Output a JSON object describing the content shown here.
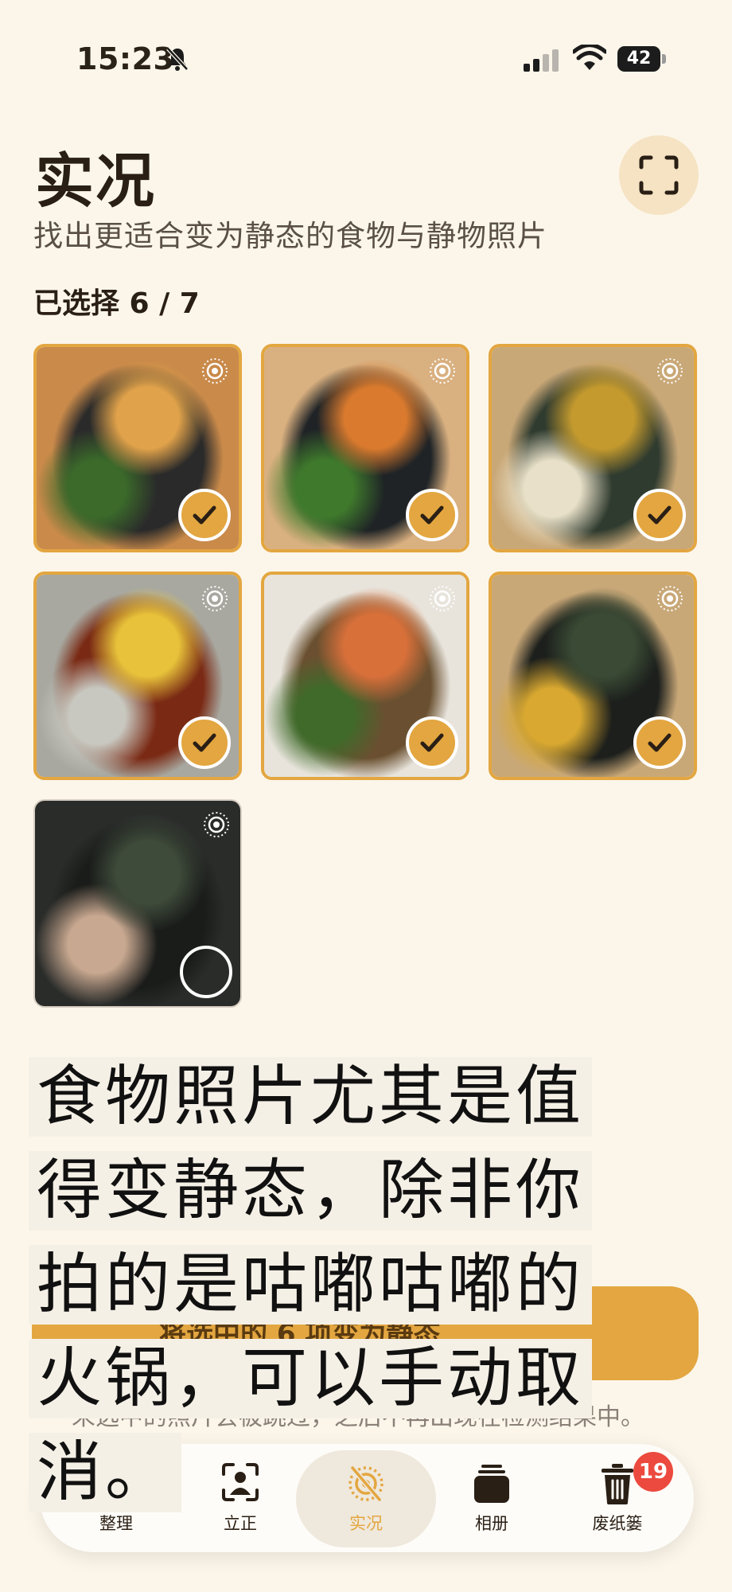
{
  "status_bar": {
    "time": "15:23",
    "battery": "42",
    "icons": [
      "bell-slash-icon",
      "signal-icon",
      "wifi-icon",
      "battery-icon"
    ]
  },
  "header": {
    "title": "实况",
    "subtitle": "找出更适合变为静态的食物与静物照片",
    "scan_icon": "scan-frame-icon"
  },
  "selection": {
    "label": "已选择 6 / 7"
  },
  "photos": [
    {
      "subject": "bibimbap table",
      "selected": true,
      "colors": [
        "#c98a4a",
        "#2a2a2a",
        "#e0a24a",
        "#3b6a2a"
      ]
    },
    {
      "subject": "bibimbap bowl",
      "selected": true,
      "colors": [
        "#d9b080",
        "#1f2326",
        "#d97a2e",
        "#3f7a2c"
      ]
    },
    {
      "subject": "soup bowl",
      "selected": true,
      "colors": [
        "#c9a878",
        "#2f3b2f",
        "#c49a2e",
        "#e8e0c8"
      ]
    },
    {
      "subject": "fried chicken",
      "selected": true,
      "colors": [
        "#a8a8a0",
        "#7a2a14",
        "#e8c23a",
        "#c8c8c0"
      ]
    },
    {
      "subject": "noodles with shrimp",
      "selected": true,
      "colors": [
        "#e8e4dc",
        "#6a5030",
        "#d8703a",
        "#3f6a2a"
      ]
    },
    {
      "subject": "kimbap plate",
      "selected": true,
      "colors": [
        "#c9a878",
        "#1c1f1c",
        "#3a4a34",
        "#d8a830"
      ]
    },
    {
      "subject": "kimbap close-up",
      "selected": false,
      "colors": [
        "#2a2c2a",
        "#1a1c1a",
        "#3e4a3a",
        "#c8a890"
      ]
    }
  ],
  "action": {
    "label": "将选中的 6 项变为静态",
    "note": "未选中的照片会被跳过，之后不再出现在检测结果中。"
  },
  "caption": {
    "lines": [
      "食物照片尤其是值",
      "得变静态，除非你",
      "拍的是咕嘟咕嘟的",
      "火锅，可以手动取",
      "消。"
    ]
  },
  "tabs": [
    {
      "label": "整理",
      "icon": "stack-icon"
    },
    {
      "label": "立正",
      "icon": "person-frame-icon"
    },
    {
      "label": "实况",
      "icon": "live-off-icon",
      "active": true
    },
    {
      "label": "相册",
      "icon": "album-icon"
    },
    {
      "label": "废纸篓",
      "icon": "trash-icon",
      "badge": "19"
    }
  ],
  "colors": {
    "accent": "#e3a640",
    "background": "#fcf6ea",
    "badge": "#ec4a3e"
  }
}
